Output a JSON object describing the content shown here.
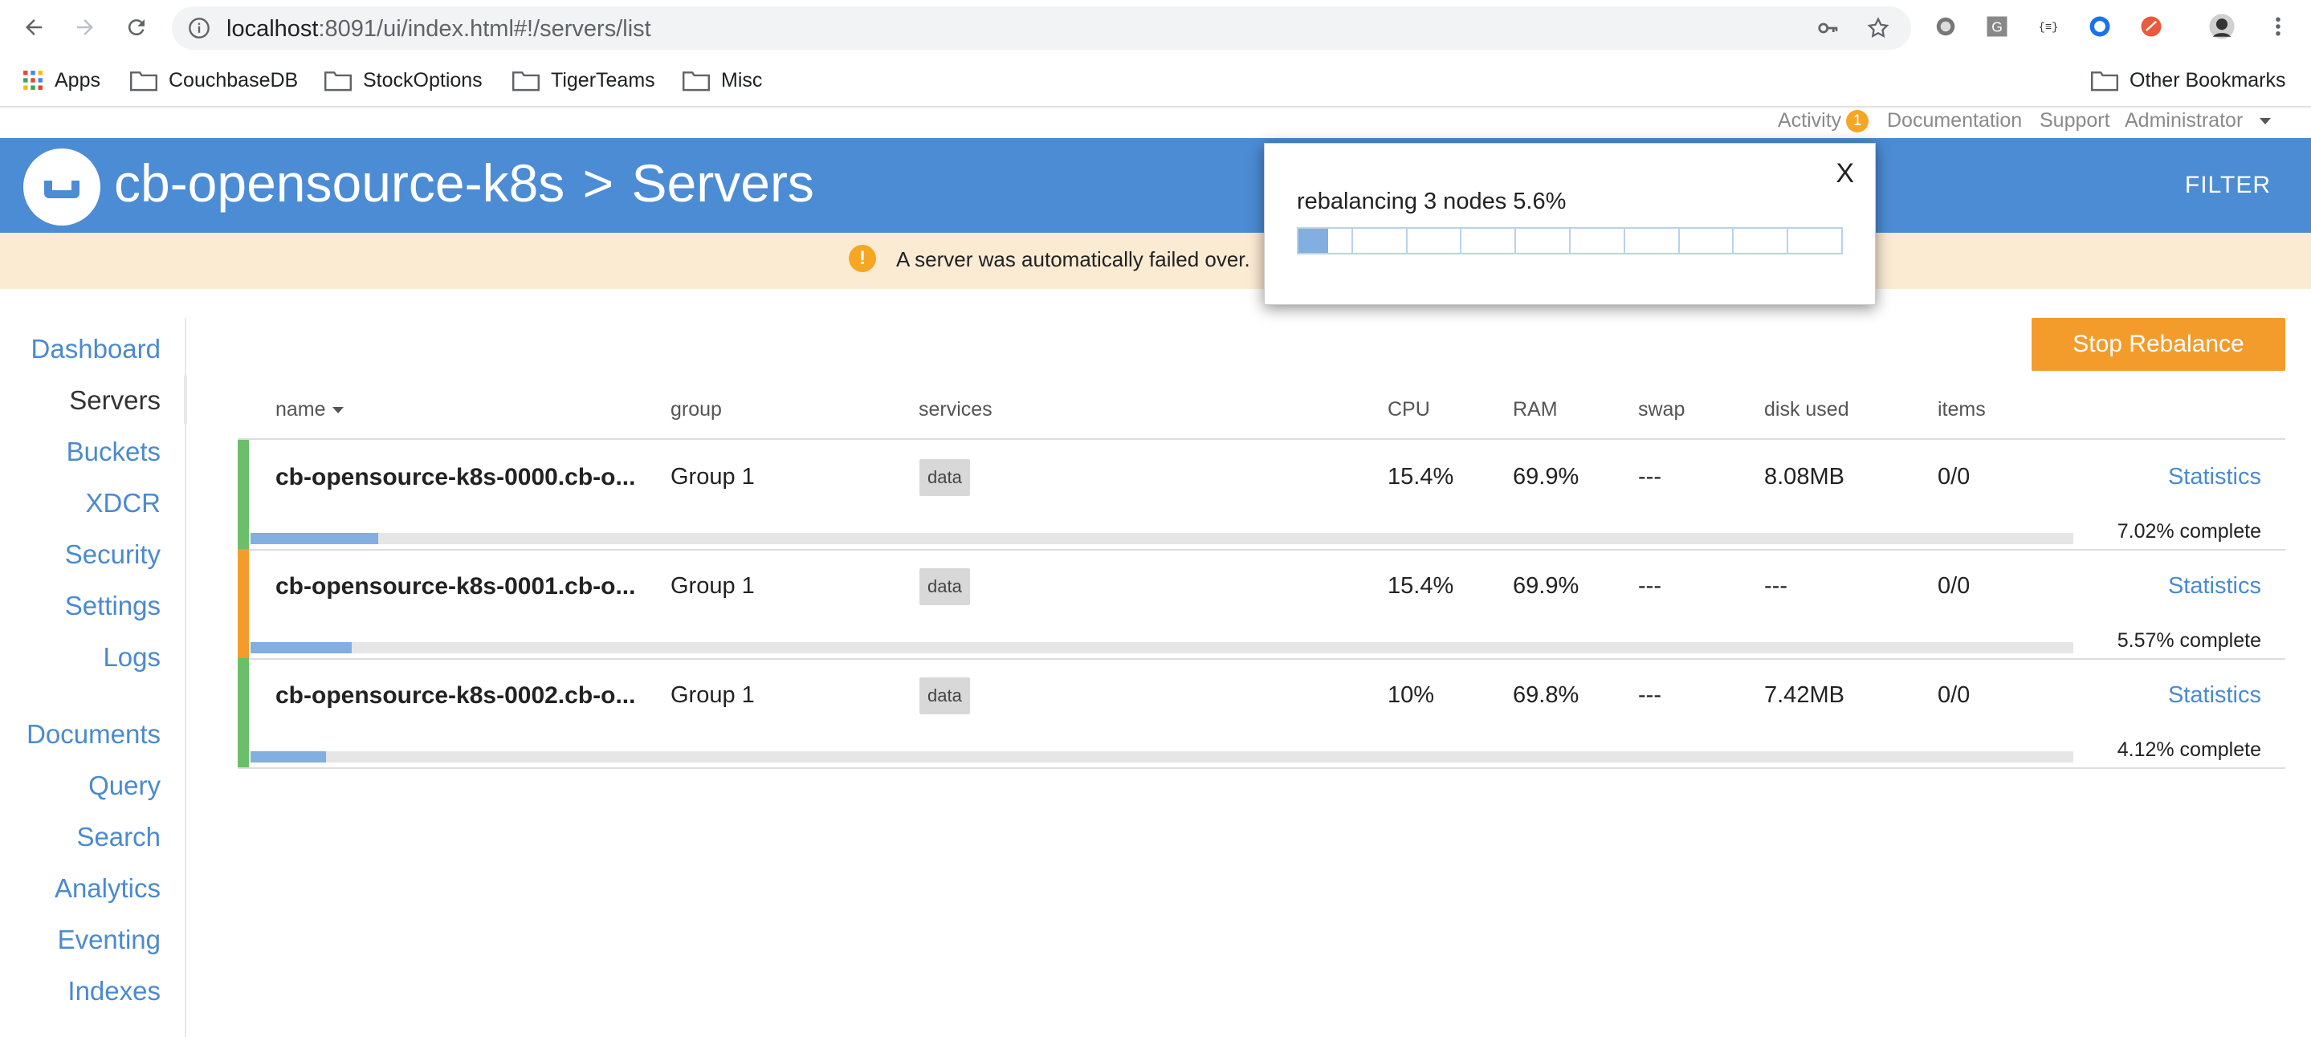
{
  "browser": {
    "url_host": "localhost",
    "url_path": ":8091/ui/index.html#!/servers/list",
    "bookmarks": [
      {
        "label": "Apps",
        "icon": "apps-grid-icon"
      },
      {
        "label": "CouchbaseDB",
        "icon": "folder-icon"
      },
      {
        "label": "StockOptions",
        "icon": "folder-icon"
      },
      {
        "label": "TigerTeams",
        "icon": "folder-icon"
      },
      {
        "label": "Misc",
        "icon": "folder-icon"
      }
    ],
    "other_bookmarks": "Other Bookmarks"
  },
  "topnav": {
    "activity": "Activity",
    "activity_count": "1",
    "documentation": "Documentation",
    "support": "Support",
    "admin": "Administrator"
  },
  "header": {
    "cluster": "cb-opensource-k8s",
    "separator": ">",
    "page": "Servers",
    "filter": "FILTER",
    "brand_color": "#4c8cd4"
  },
  "alert": {
    "icon": "!",
    "text": "A server was automatically failed over."
  },
  "sidebar": {
    "group1": [
      "Dashboard",
      "Servers",
      "Buckets",
      "XDCR",
      "Security",
      "Settings",
      "Logs"
    ],
    "group2": [
      "Documents",
      "Query",
      "Search",
      "Analytics",
      "Eventing",
      "Indexes"
    ],
    "active": "Servers"
  },
  "main": {
    "stop_rebalance": "Stop Rebalance",
    "columns": {
      "name": "name",
      "group": "group",
      "services": "services",
      "cpu": "CPU",
      "ram": "RAM",
      "swap": "swap",
      "disk": "disk used",
      "items": "items"
    },
    "servers": [
      {
        "name": "cb-opensource-k8s-0000.cb-o...",
        "group": "Group 1",
        "service": "data",
        "cpu": "15.4%",
        "ram": "69.9%",
        "swap": "---",
        "disk": "8.08MB",
        "items": "0/0",
        "stats": "Statistics",
        "progress": 7.02,
        "progress_text": "7.02% complete",
        "status_color": "#6cbf6a"
      },
      {
        "name": "cb-opensource-k8s-0001.cb-o...",
        "group": "Group 1",
        "service": "data",
        "cpu": "15.4%",
        "ram": "69.9%",
        "swap": "---",
        "disk": "---",
        "items": "0/0",
        "stats": "Statistics",
        "progress": 5.57,
        "progress_text": "5.57% complete",
        "status_color": "#f39c2b"
      },
      {
        "name": "cb-opensource-k8s-0002.cb-o...",
        "group": "Group 1",
        "service": "data",
        "cpu": "10%",
        "ram": "69.8%",
        "swap": "---",
        "disk": "7.42MB",
        "items": "0/0",
        "stats": "Statistics",
        "progress": 4.12,
        "progress_text": "4.12% complete",
        "status_color": "#6cbf6a"
      }
    ]
  },
  "modal": {
    "close": "X",
    "message": "rebalancing 3 nodes 5.6%",
    "progress": 5.6
  }
}
